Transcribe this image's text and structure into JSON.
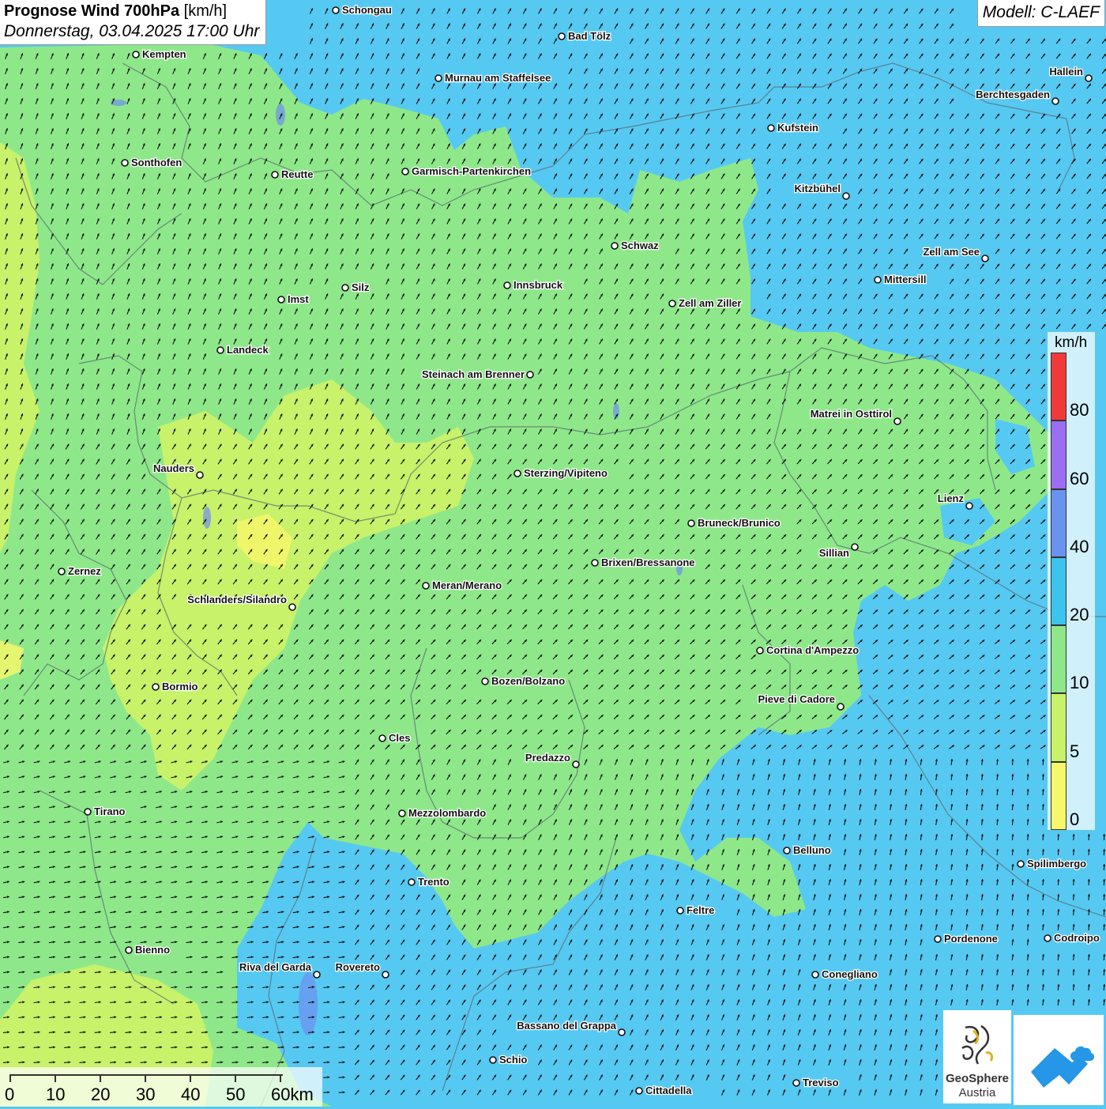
{
  "header": {
    "title_bold": "Prognose Wind 700hPa",
    "title_unit": "[km/h]",
    "date": "Donnerstag, 03.04.2025 17:00 Uhr"
  },
  "model": "Modell: C-LAEF",
  "legend": {
    "unit": "km/h",
    "bins": [
      {
        "from": 0,
        "to": 5,
        "color": "#f6f76a"
      },
      {
        "from": 5,
        "to": 10,
        "color": "#c7f26a"
      },
      {
        "from": 10,
        "to": 20,
        "color": "#8ee88a"
      },
      {
        "from": 20,
        "to": 40,
        "color": "#3cc4ee"
      },
      {
        "from": 40,
        "to": 60,
        "color": "#6a93f0"
      },
      {
        "from": 60,
        "to": 80,
        "color": "#9b6ef2"
      },
      {
        "from": 80,
        "to": 100,
        "color": "#f03a3a"
      }
    ],
    "labels": [
      "0",
      "5",
      "10",
      "20",
      "40",
      "60",
      "80"
    ]
  },
  "scale_bar": {
    "labels": [
      "0",
      "10",
      "20",
      "30",
      "40",
      "50",
      "60km"
    ]
  },
  "cities": [
    {
      "name": "Schongau",
      "label_side": "right"
    },
    {
      "name": "Bad Tölz",
      "label_side": "right"
    },
    {
      "name": "Kempten",
      "label_side": "right"
    },
    {
      "name": "Murnau am Staffelsee",
      "label_side": "right"
    },
    {
      "name": "Hallein",
      "label_side": "left"
    },
    {
      "name": "Berchtesgaden",
      "label_side": "left"
    },
    {
      "name": "Kufstein",
      "label_side": "right"
    },
    {
      "name": "Sonthofen",
      "label_side": "right"
    },
    {
      "name": "Reutte",
      "label_side": "right"
    },
    {
      "name": "Garmisch-Partenkirchen",
      "label_side": "right"
    },
    {
      "name": "Kitzbühel",
      "label_side": "left"
    },
    {
      "name": "Schwaz",
      "label_side": "right"
    },
    {
      "name": "Zell am See",
      "label_side": "left"
    },
    {
      "name": "Mittersill",
      "label_side": "right"
    },
    {
      "name": "Innsbruck",
      "label_side": "right"
    },
    {
      "name": "Silz",
      "label_side": "right"
    },
    {
      "name": "Imst",
      "label_side": "right"
    },
    {
      "name": "Zell am Ziller",
      "label_side": "right"
    },
    {
      "name": "Landeck",
      "label_side": "right"
    },
    {
      "name": "Steinach am Brenner",
      "label_side": "left"
    },
    {
      "name": "Matrei in Osttirol",
      "label_side": "left"
    },
    {
      "name": "Nauders",
      "label_side": "left"
    },
    {
      "name": "Sterzing/Vipiteno",
      "label_side": "right"
    },
    {
      "name": "Lienz",
      "label_side": "left"
    },
    {
      "name": "Bruneck/Brunico",
      "label_side": "right"
    },
    {
      "name": "Sillian",
      "label_side": "left"
    },
    {
      "name": "Brixen/Bressanone",
      "label_side": "right"
    },
    {
      "name": "Zernez",
      "label_side": "right"
    },
    {
      "name": "Meran/Merano",
      "label_side": "right"
    },
    {
      "name": "Schlanders/Silandro",
      "label_side": "left"
    },
    {
      "name": "Cortina d'Ampezzo",
      "label_side": "right"
    },
    {
      "name": "Bozen/Bolzano",
      "label_side": "right"
    },
    {
      "name": "Bormio",
      "label_side": "right"
    },
    {
      "name": "Pieve di Cadore",
      "label_side": "left"
    },
    {
      "name": "Cles",
      "label_side": "right"
    },
    {
      "name": "Predazzo",
      "label_side": "left"
    },
    {
      "name": "Tirano",
      "label_side": "right"
    },
    {
      "name": "Mezzolombardo",
      "label_side": "right"
    },
    {
      "name": "Belluno",
      "label_side": "right"
    },
    {
      "name": "Spilimbergo",
      "label_side": "right"
    },
    {
      "name": "Trento",
      "label_side": "right"
    },
    {
      "name": "Feltre",
      "label_side": "right"
    },
    {
      "name": "Pordenone",
      "label_side": "right"
    },
    {
      "name": "Codroipo",
      "label_side": "right"
    },
    {
      "name": "Bienno",
      "label_side": "right"
    },
    {
      "name": "Riva del Garda",
      "label_side": "left"
    },
    {
      "name": "Rovereto",
      "label_side": "left"
    },
    {
      "name": "Conegliano",
      "label_side": "right"
    },
    {
      "name": "Bassano del Grappa",
      "label_side": "left"
    },
    {
      "name": "Schio",
      "label_side": "right"
    },
    {
      "name": "Treviso",
      "label_side": "right"
    },
    {
      "name": "Cittadella",
      "label_side": "right"
    }
  ],
  "logo": {
    "name": "GeoSphere",
    "sub": "Austria"
  },
  "colors": {
    "calm_yellow": "#f6f76a",
    "light_green": "#c7f26a",
    "green": "#8ee88a",
    "blue": "#56c9f2",
    "arrow": "#111111",
    "border": "#5a6a72"
  }
}
